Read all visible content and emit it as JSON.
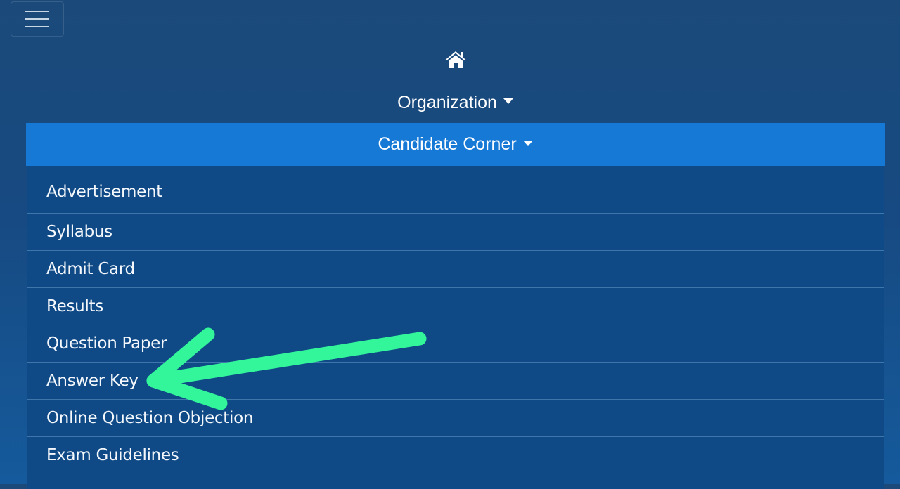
{
  "navbar": {
    "toggle_icon": "hamburger-menu-icon",
    "home_icon": "home-icon"
  },
  "menu": {
    "organization_label": "Organization",
    "candidate_corner_label": "Candidate Corner"
  },
  "dropdown": {
    "items": [
      {
        "label": "Advertisement"
      },
      {
        "label": "Syllabus"
      },
      {
        "label": "Admit Card"
      },
      {
        "label": "Results"
      },
      {
        "label": "Question Paper"
      },
      {
        "label": "Answer Key"
      },
      {
        "label": "Online Question Objection"
      },
      {
        "label": "Exam Guidelines"
      }
    ]
  },
  "annotation": {
    "arrow_color": "#33f59a",
    "points_to": "Answer Key"
  },
  "colors": {
    "active_menu_bg": "#1779d6",
    "dropdown_bg": "#0f4a86"
  }
}
